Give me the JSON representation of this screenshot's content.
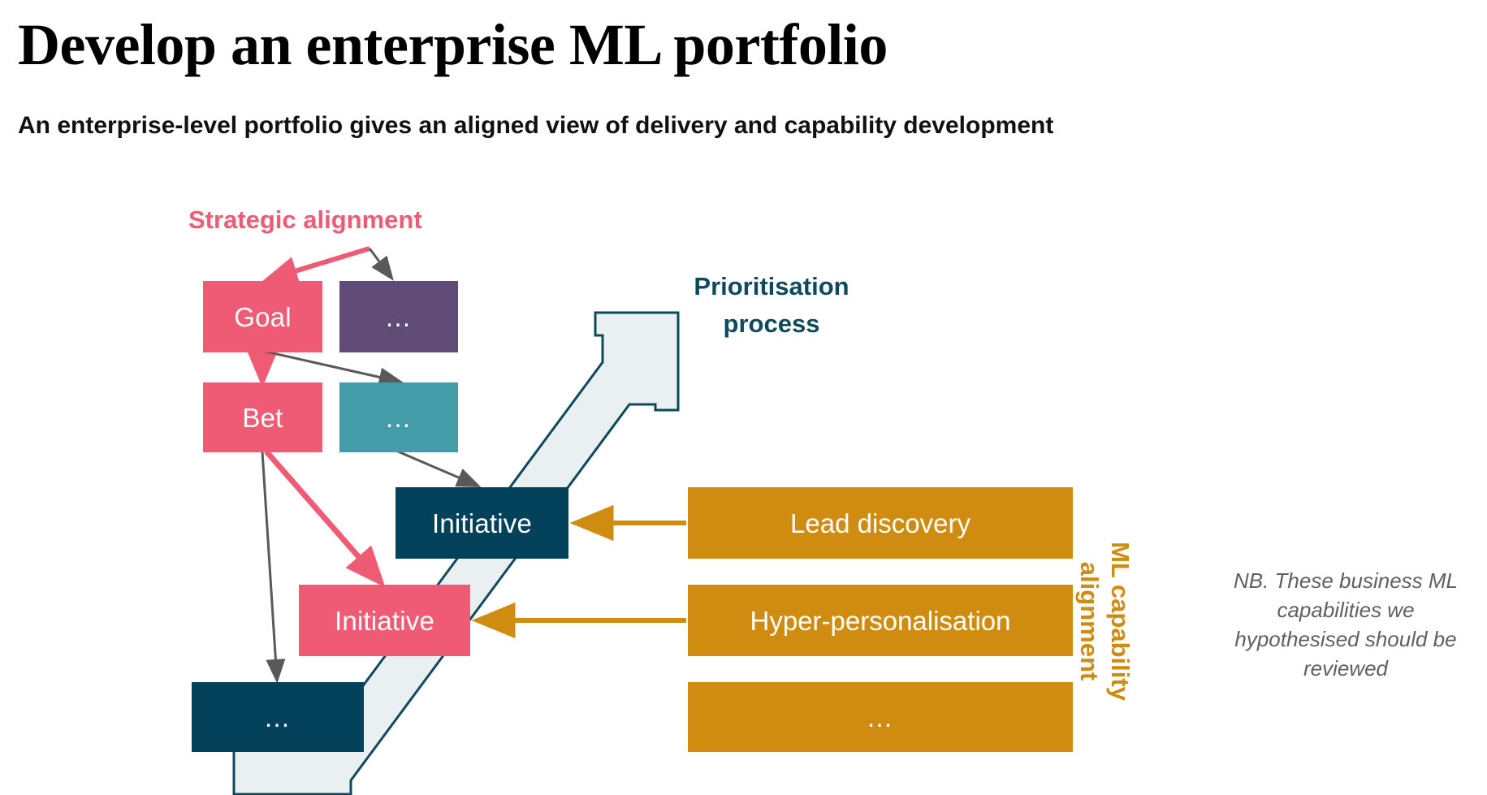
{
  "header": {
    "title": "Develop an enterprise ML portfolio",
    "subtitle": "An enterprise-level portfolio gives an aligned view of delivery and capability development"
  },
  "labels": {
    "strategic_alignment": "Strategic alignment",
    "prioritisation_process": "Prioritisation\nprocess",
    "ml_capability_alignment": "ML capability\nalignment",
    "note": "NB. These business ML capabilities we hypothesised should be reviewed"
  },
  "hierarchy": {
    "nodes": [
      {
        "id": "goal",
        "label": "Goal",
        "color": "#ef5b74",
        "level": "goal"
      },
      {
        "id": "goal-more",
        "label": "…",
        "color": "#5f4b76",
        "level": "goal"
      },
      {
        "id": "bet",
        "label": "Bet",
        "color": "#ef5b74",
        "level": "bet"
      },
      {
        "id": "bet-more",
        "label": "…",
        "color": "#429da8",
        "level": "bet"
      },
      {
        "id": "initiative-1",
        "label": "Initiative",
        "color": "#04415a",
        "level": "initiative"
      },
      {
        "id": "initiative-2",
        "label": "Initiative",
        "color": "#ef5b74",
        "level": "initiative"
      },
      {
        "id": "initiative-more",
        "label": "…",
        "color": "#04415a",
        "level": "initiative"
      }
    ]
  },
  "capabilities": {
    "color": "#cf8c11",
    "items": [
      {
        "id": "lead-discovery",
        "label": "Lead discovery"
      },
      {
        "id": "hyper-personalisation",
        "label": "Hyper-personalisation"
      },
      {
        "id": "capability-more",
        "label": "…"
      }
    ]
  },
  "colors": {
    "pink": "#ef5b74",
    "purple": "#5f4b76",
    "teal": "#429da8",
    "navy": "#04415a",
    "gold": "#cf8c11",
    "grey_arrow": "#595959",
    "big_arrow_fill": "#eaeff2",
    "big_arrow_stroke": "#0e4a5e",
    "note_grey": "#5f6063"
  }
}
